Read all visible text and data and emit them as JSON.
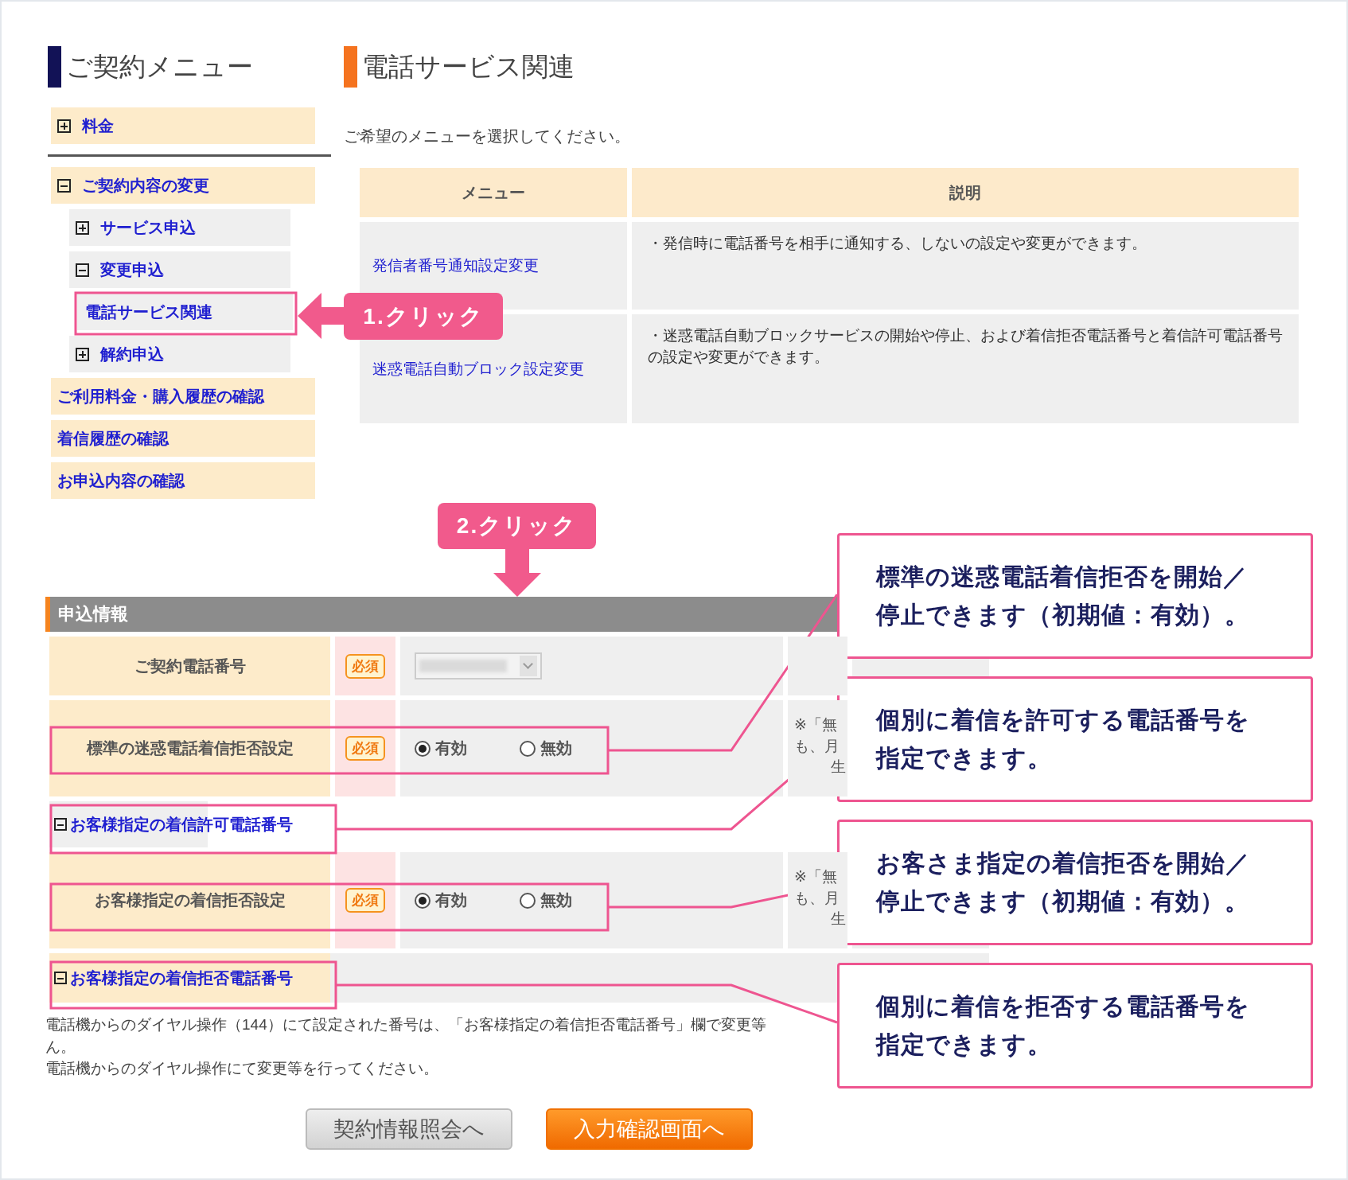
{
  "sidebar": {
    "title": "ご契約メニュー",
    "items": [
      {
        "label": "料金",
        "kind": "folder",
        "expanded": false
      },
      {
        "label": "ご契約内容の変更",
        "kind": "folder",
        "expanded": true,
        "children": [
          {
            "label": "サービス申込",
            "kind": "folder",
            "expanded": false
          },
          {
            "label": "変更申込",
            "kind": "folder",
            "expanded": true,
            "children": [
              {
                "label": "電話サービス関連",
                "kind": "link"
              }
            ]
          },
          {
            "label": "解約申込",
            "kind": "folder",
            "expanded": false
          }
        ]
      },
      {
        "label": "ご利用料金・購入履歴の確認",
        "kind": "link"
      },
      {
        "label": "着信履歴の確認",
        "kind": "link"
      },
      {
        "label": "お申込内容の確認",
        "kind": "link"
      }
    ]
  },
  "main": {
    "title": "電話サービス関連",
    "instruction": "ご希望のメニューを選択してください。",
    "table": {
      "columns": [
        "メニュー",
        "説明"
      ],
      "rows": [
        {
          "menu": "発信者番号通知設定変更",
          "description": "・発信時に電話番号を相手に通知する、しないの設定や変更ができます。"
        },
        {
          "menu": "迷惑電話自動ブロック設定変更",
          "description": "・迷惑電話自動ブロックサービスの開始や停止、および着信拒否電話番号と着信許可電話番号の設定や変更ができます。"
        }
      ]
    }
  },
  "form": {
    "title": "申込情報",
    "rows": [
      {
        "kind": "select",
        "label": "ご契約電話番号",
        "required": "必須"
      },
      {
        "kind": "radio",
        "label": "標準の迷惑電話着信拒否設定",
        "required": "必須",
        "options": [
          {
            "label": "有効",
            "selected": true
          },
          {
            "label": "無効",
            "selected": false
          }
        ],
        "note": [
          "※「無",
          "も、月",
          "生"
        ]
      },
      {
        "kind": "section",
        "label": "お客様指定の着信許可電話番号",
        "expanded": true
      },
      {
        "kind": "radio",
        "label": "お客様指定の着信拒否設定",
        "required": "必須",
        "options": [
          {
            "label": "有効",
            "selected": true
          },
          {
            "label": "無効",
            "selected": false
          }
        ],
        "note": [
          "※「無",
          "も、月",
          "生"
        ]
      },
      {
        "kind": "section",
        "label": "お客様指定の着信拒否電話番号",
        "expanded": true
      }
    ],
    "notes": [
      "電話機からのダイヤル操作（144）にて設定された番号は、「お客様指定の着信拒否電話番号」欄で変更等",
      "ん。",
      "電話機からのダイヤル操作にて変更等を行ってください。"
    ],
    "buttons": [
      {
        "label": "契約情報照会へ",
        "kind": "secondary"
      },
      {
        "label": "入力確認画面へ",
        "kind": "primary"
      }
    ]
  },
  "annotations": {
    "steps": [
      "1.クリック",
      "2.クリック"
    ],
    "callouts": [
      [
        "標準の迷惑電話着信拒否を開始／",
        "停止できます（初期値：有効）。"
      ],
      [
        "個別に着信を許可する電話番号を",
        "指定できます。"
      ],
      [
        "お客さま指定の着信拒否を開始／",
        "停止できます（初期値：有効）。"
      ],
      [
        "個別に着信を拒否する電話番号を",
        "指定できます。"
      ]
    ]
  }
}
